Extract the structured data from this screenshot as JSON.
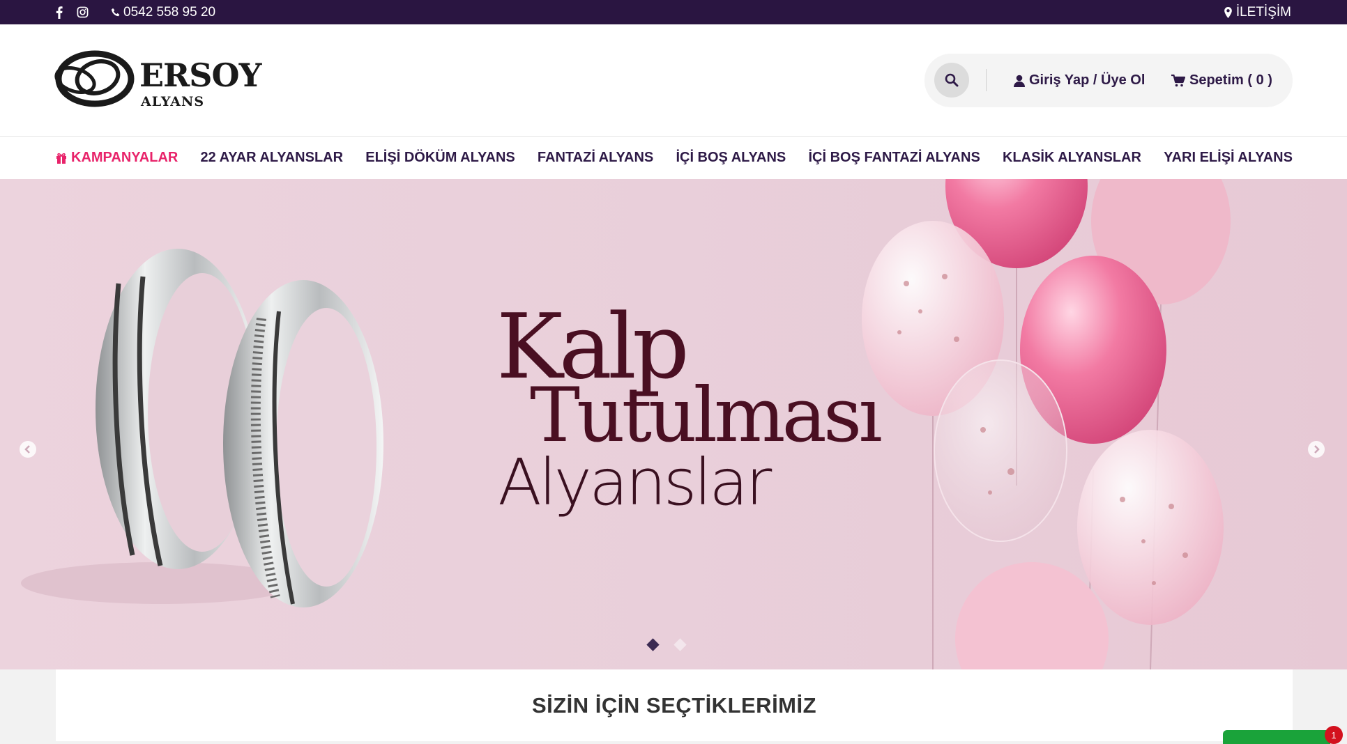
{
  "topbar": {
    "phone": "0542 558 95 20",
    "contact": "İLETİŞİM",
    "icons": [
      "facebook-icon",
      "instagram-icon",
      "phone-icon",
      "map-marker-icon"
    ]
  },
  "header": {
    "logo_main": "ERSOY",
    "logo_sub": "ALYANS",
    "login_label": "Giriş Yap / Üye Ol",
    "cart_label": "Sepetim ( 0 )"
  },
  "nav": {
    "items": [
      {
        "label": "KAMPANYALAR",
        "icon": "gift-icon"
      },
      {
        "label": "22 AYAR ALYANSLAR"
      },
      {
        "label": "ELİŞİ DÖKÜM ALYANS"
      },
      {
        "label": "FANTAZİ ALYANS"
      },
      {
        "label": "İÇİ BOŞ ALYANS"
      },
      {
        "label": "İÇİ BOŞ FANTAZİ ALYANS"
      },
      {
        "label": "KLASİK ALYANSLAR"
      },
      {
        "label": "YARI ELİŞİ ALYANS"
      }
    ]
  },
  "hero": {
    "line1": "Kalp",
    "line2": "Tutulması",
    "line3": "Alyanslar",
    "active_slide": 1,
    "slide_count": 2
  },
  "section": {
    "title": "SİZİN İÇİN SEÇTİKLERİMİZ"
  },
  "chat": {
    "badge": "1"
  },
  "colors": {
    "topbar": "#2a1541",
    "nav_text": "#2e1a47",
    "promo": "#e8236a",
    "hero_text": "#4a0f22",
    "chat": "#1aa33a",
    "badge": "#d3111e"
  }
}
